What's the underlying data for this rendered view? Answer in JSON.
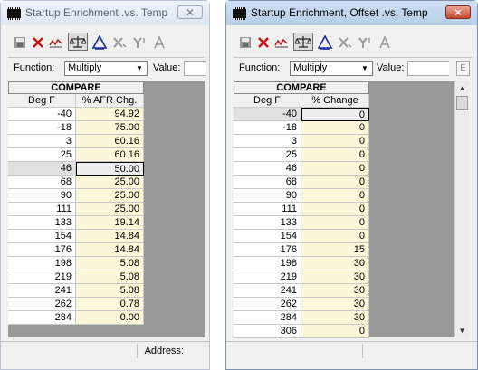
{
  "window1": {
    "title": "Startup Enrichment .vs. Temp",
    "close_label": "✕",
    "function_label": "Function:",
    "function_value": "Multiply",
    "value_label": "Value:",
    "grid_header": "COMPARE",
    "col_label": "Deg F",
    "col_value": "%  AFR Chg.",
    "rows": [
      {
        "label": "-40",
        "value": "94.92"
      },
      {
        "label": "-18",
        "value": "75.00"
      },
      {
        "label": "3",
        "value": "60.16"
      },
      {
        "label": "25",
        "value": "60.16"
      },
      {
        "label": "46",
        "value": "50.00"
      },
      {
        "label": "68",
        "value": "25.00"
      },
      {
        "label": "90",
        "value": "25.00"
      },
      {
        "label": "111",
        "value": "25.00"
      },
      {
        "label": "133",
        "value": "19.14"
      },
      {
        "label": "154",
        "value": "14.84"
      },
      {
        "label": "176",
        "value": "14.84"
      },
      {
        "label": "198",
        "value": "5.08"
      },
      {
        "label": "219",
        "value": "5.08"
      },
      {
        "label": "241",
        "value": "5.08"
      },
      {
        "label": "262",
        "value": "0.78"
      },
      {
        "label": "284",
        "value": "0.00"
      }
    ],
    "selected_row_label": "46",
    "address_label": "Address:"
  },
  "window2": {
    "title": "Startup Enrichment, Offset .vs. Temp",
    "close_label": "✕",
    "function_label": "Function:",
    "function_value": "Multiply",
    "value_label": "Value:",
    "extra_button": "E",
    "grid_header": "COMPARE",
    "col_label": "Deg F",
    "col_value": "% Change",
    "rows": [
      {
        "label": "-40",
        "value": "0"
      },
      {
        "label": "-18",
        "value": "0"
      },
      {
        "label": "3",
        "value": "0"
      },
      {
        "label": "25",
        "value": "0"
      },
      {
        "label": "46",
        "value": "0"
      },
      {
        "label": "68",
        "value": "0"
      },
      {
        "label": "90",
        "value": "0"
      },
      {
        "label": "111",
        "value": "0"
      },
      {
        "label": "133",
        "value": "0"
      },
      {
        "label": "154",
        "value": "0"
      },
      {
        "label": "176",
        "value": "15"
      },
      {
        "label": "198",
        "value": "30"
      },
      {
        "label": "219",
        "value": "30"
      },
      {
        "label": "241",
        "value": "30"
      },
      {
        "label": "262",
        "value": "30"
      },
      {
        "label": "284",
        "value": "30"
      },
      {
        "label": "306",
        "value": "0"
      }
    ],
    "selected_row_label": "-40"
  },
  "toolbar_icons": [
    "save-icon",
    "delete-icon",
    "graph-icon",
    "compare-scale-icon",
    "triangle-icon",
    "x-axis-icon",
    "y-axis-icon",
    "text-a-icon"
  ],
  "colors": {
    "value_cell_bg": "#fbf7d8",
    "grid_bg": "#999999",
    "close_active": "#c84630"
  }
}
